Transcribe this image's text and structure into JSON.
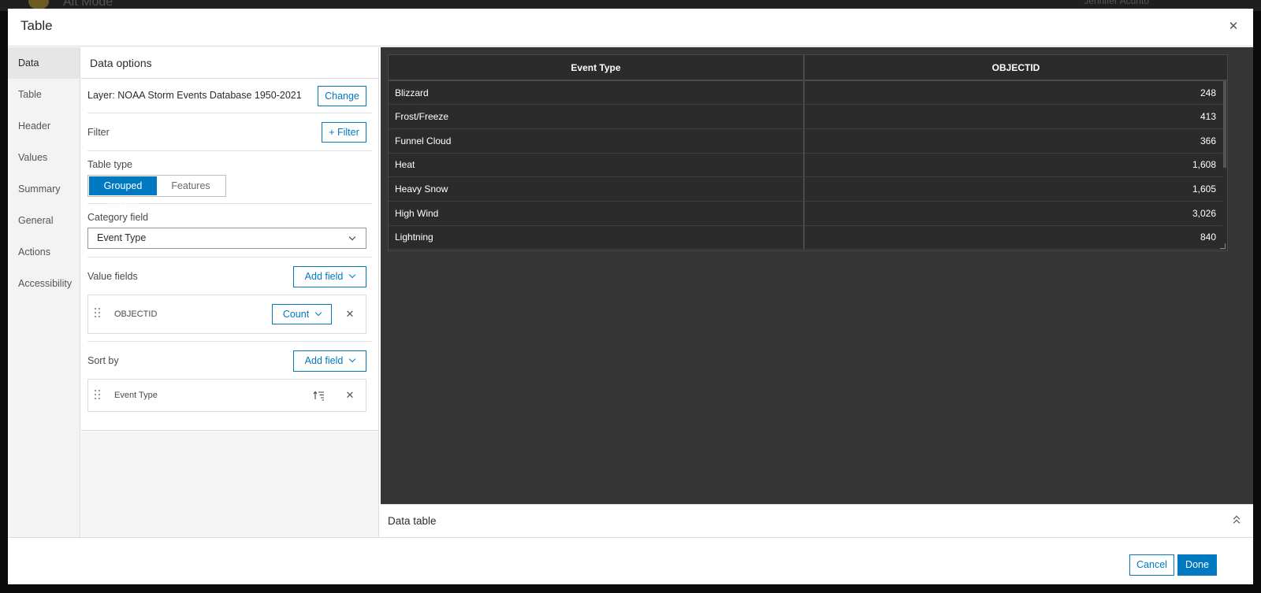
{
  "background": {
    "app_title": "Alt Mode",
    "user": "Jennifer Acunto"
  },
  "dialog": {
    "title": "Table",
    "close_icon": "close-icon"
  },
  "nav": {
    "items": [
      {
        "label": "Data",
        "active": true
      },
      {
        "label": "Table"
      },
      {
        "label": "Header"
      },
      {
        "label": "Values"
      },
      {
        "label": "Summary"
      },
      {
        "label": "General"
      },
      {
        "label": "Actions"
      },
      {
        "label": "Accessibility"
      }
    ]
  },
  "data_options": {
    "heading": "Data options",
    "layer_label": "Layer: NOAA Storm Events Database 1950-2021",
    "change_button": "Change",
    "filter_label": "Filter",
    "filter_button": "+ Filter",
    "table_type_label": "Table type",
    "table_type_options": [
      "Grouped values",
      "Features"
    ],
    "table_type_selected": "Grouped values",
    "category_field_label": "Category field",
    "category_field_value": "Event Type",
    "value_fields_label": "Value fields",
    "add_field_button": "Add field",
    "value_field": {
      "name": "OBJECTID",
      "statistic": "Count"
    },
    "sort_by_label": "Sort by",
    "sort_field": {
      "name": "Event Type",
      "order_icon": "sort-ascending-icon"
    }
  },
  "preview": {
    "columns": [
      "Event Type",
      "OBJECTID"
    ],
    "rows": [
      [
        "Blizzard",
        "248"
      ],
      [
        "Frost/Freeze",
        "413"
      ],
      [
        "Funnel Cloud",
        "366"
      ],
      [
        "Heat",
        "1,608"
      ],
      [
        "Heavy Snow",
        "1,605"
      ],
      [
        "High Wind",
        "3,026"
      ],
      [
        "Lightning",
        "840"
      ]
    ],
    "panel_title": "Data table"
  },
  "footer": {
    "cancel": "Cancel",
    "done": "Done"
  },
  "colors": {
    "accent": "#0079c1",
    "preview_bg": "#353535",
    "grid_bg": "#2b2b2b"
  }
}
